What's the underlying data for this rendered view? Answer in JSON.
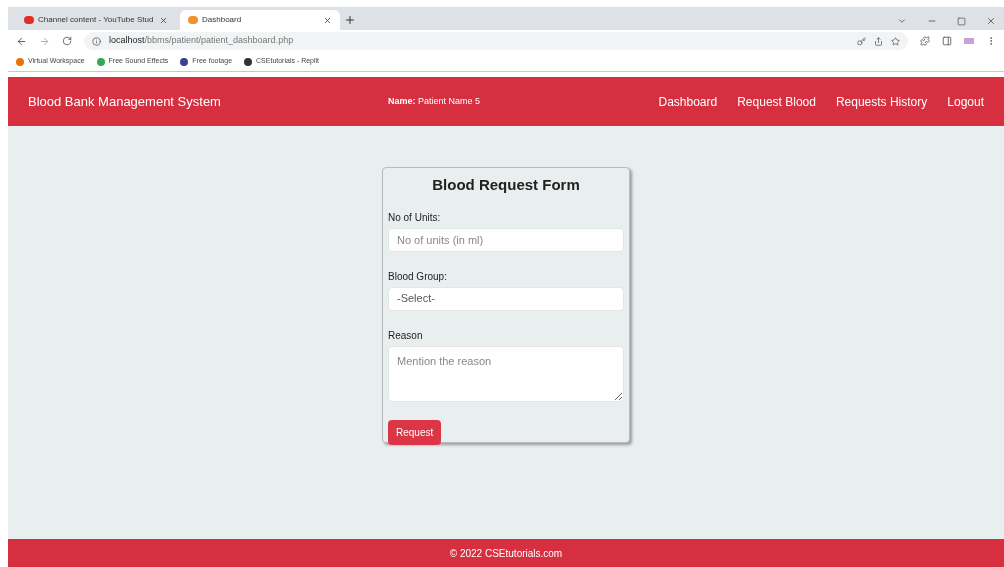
{
  "browser": {
    "tabs": [
      {
        "title": "Channel content - YouTube Stud",
        "selected": false
      },
      {
        "title": "Dashboard",
        "selected": true
      }
    ],
    "url_host": "localhost",
    "url_path": "/bbms/patient/patient_dashboard.php",
    "bookmarks": [
      "Virtual Workspace",
      "Free Sound Effects",
      "Free footage",
      "CSEtutorials - Replit"
    ]
  },
  "navbar": {
    "brand": "Blood Bank Management System",
    "user": "**Name:** Patient Name 5",
    "links": [
      "Dashboard",
      "Request Blood",
      "Requests History",
      "Logout"
    ]
  },
  "form": {
    "title": "Blood Request Form",
    "fields": [
      {
        "kind": "input",
        "label": "No of Units:",
        "placeholder": "No of units (in ml)"
      },
      {
        "kind": "select",
        "label": "Blood Group:",
        "value": "-Select-"
      },
      {
        "kind": "textarea",
        "label": "Reason",
        "placeholder": "Mention the reason"
      }
    ],
    "submit": "Request"
  },
  "footer": "© 2022 CSEtutorials.com"
}
